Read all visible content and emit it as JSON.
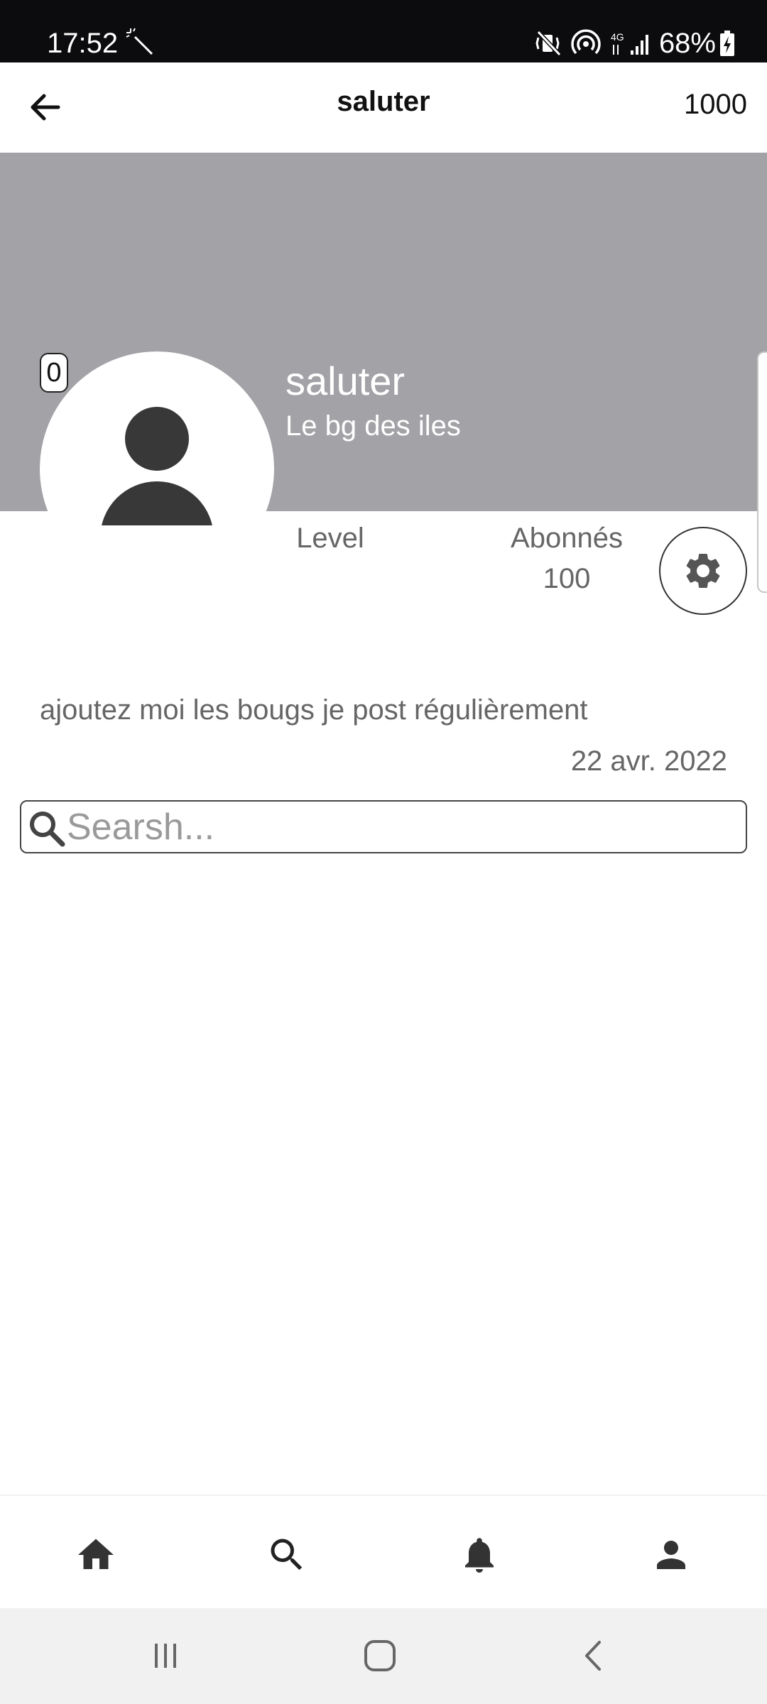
{
  "status_bar": {
    "time": "17:52",
    "battery_text": "68%",
    "network_label": "4G"
  },
  "app_bar": {
    "title": "saluter",
    "count": "1000"
  },
  "profile": {
    "name": "saluter",
    "subtitle": "Le bg des iles",
    "badge": "0"
  },
  "stats": {
    "level_label": "Level",
    "abonnes_label": "Abonnés",
    "abonnes_value": "100"
  },
  "bio": {
    "text": "ajoutez moi les bougs je post régulièrement",
    "date": "22 avr. 2022"
  },
  "search": {
    "placeholder": "Searsh...",
    "value": ""
  },
  "colors": {
    "status_bar_bg": "#0c0c0e",
    "cover_bg": "#a3a3a7",
    "icon_dark": "#383838",
    "text_muted": "#666666",
    "system_nav_bg": "#f1f1f1"
  },
  "icons": {
    "back": "arrow-left-icon",
    "settings": "gear-icon",
    "search": "search-icon",
    "nav": [
      "home-icon",
      "search-icon",
      "bell-icon",
      "person-icon"
    ],
    "system": [
      "recents-icon",
      "home-square-icon",
      "back-chevron-icon"
    ]
  }
}
